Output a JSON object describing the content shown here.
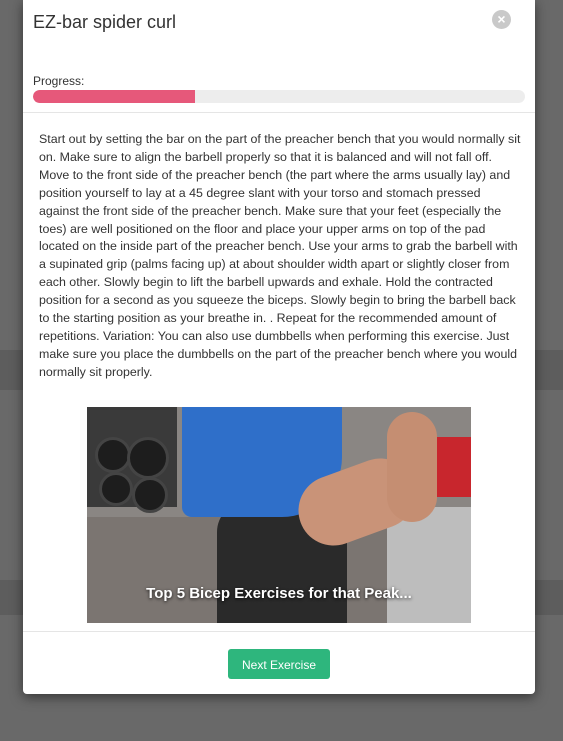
{
  "modal": {
    "title": "EZ-bar spider curl",
    "close_icon": "close-icon",
    "progress_label": "Progress:",
    "progress": 0.33,
    "progress_color": "#e6587a",
    "description": "Start out by setting the bar on the part of the preacher bench that you would normally sit on. Make sure to align the barbell properly so that it is balanced and will not fall off. Move to the front side of the preacher bench (the part where the arms usually lay) and position yourself to lay at a 45 degree slant with your torso and stomach pressed against the front side of the preacher bench. Make sure that your feet (especially the toes) are well positioned on the floor and place your upper arms on top of the pad located on the inside part of the preacher bench. Use your arms to grab the barbell with a supinated grip (palms facing up) at about shoulder width apart or slightly closer from each other. Slowly begin to lift the barbell upwards and exhale. Hold the contracted position for a second as you squeeze the biceps. Slowly begin to bring the barbell back to the starting position as your breathe in. . Repeat for the recommended amount of repetitions. Variation: You can also use dumbbells when performing this exercise. Just make sure you place the dumbbells on the part of the preacher bench where you would normally sit properly.",
    "video_caption": "Top 5 Bicep Exercises for that Peak...",
    "next_button_label": "Next Exercise",
    "next_button_color": "#2eb67d"
  }
}
